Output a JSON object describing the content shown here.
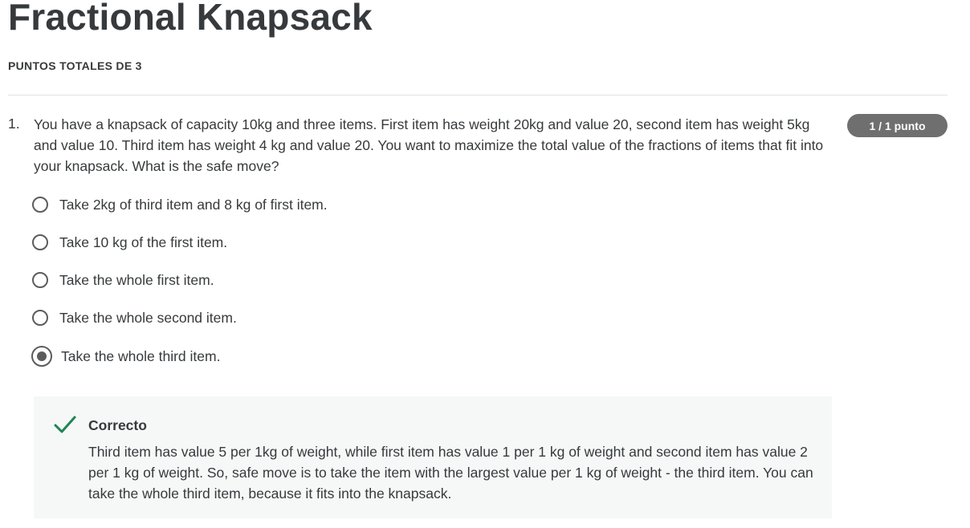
{
  "header": {
    "title": "Fractional Knapsack",
    "points_total": "PUNTOS TOTALES DE 3"
  },
  "question": {
    "number": "1.",
    "text": "You have a knapsack of capacity 10kg and three items. First item has weight 20kg and value 20, second item has weight 5kg and value 10. Third item has weight 4 kg and value 20. You want to maximize the total value of the fractions of items that fit into your knapsack. What is the safe move?",
    "score": "1 / 1 punto",
    "options": [
      {
        "label": "Take 2kg of third item and 8 kg of first item.",
        "selected": false
      },
      {
        "label": "Take 10 kg of the first item.",
        "selected": false
      },
      {
        "label": "Take the whole first item.",
        "selected": false
      },
      {
        "label": "Take the whole second item.",
        "selected": false
      },
      {
        "label": "Take the whole third item.",
        "selected": true
      }
    ]
  },
  "feedback": {
    "icon": "checkmark-icon",
    "title": "Correcto",
    "text": "Third item has value 5 per 1kg of weight, while first item has value 1 per 1 kg of weight and second item has value 2 per 1 kg of weight. So, safe move is to take the item with the largest value per 1 kg of weight - the third item. You can take the whole third item, because it fits into the knapsack."
  },
  "colors": {
    "text": "#373a3c",
    "badge_bg": "#6f6f6f",
    "feedback_bg": "#f5f8f7",
    "check_green": "#1f8354",
    "radio_border": "#5c5c5c"
  }
}
